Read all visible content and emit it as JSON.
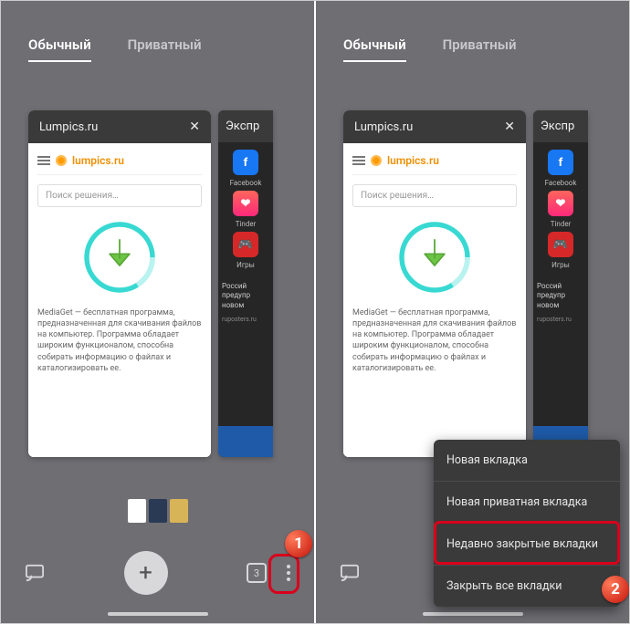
{
  "modes": {
    "normal": "Обычный",
    "private": "Приватный"
  },
  "card1": {
    "title": "Lumpics.ru",
    "brand": "lumpics.ru",
    "search_placeholder": "Поиск решения…",
    "body": "MediaGet — бесплатная программа, предназначенная для скачивания файлов на компьютер. Программа обладает широким функционалом, способна собирать информацию о файлах и каталогизировать ее."
  },
  "card2": {
    "title": "Экспр",
    "apps": {
      "fb": "Facebook",
      "tinder": "Tinder",
      "games": "Игры"
    },
    "news": "Россий\nпредупр\nновом",
    "source": "ruposters.ru"
  },
  "toolbar": {
    "tab_count": "3"
  },
  "menu": {
    "new_tab": "Новая вкладка",
    "new_private": "Новая приватная вкладка",
    "recent_closed": "Недавно закрытые вкладки",
    "close_all": "Закрыть все вкладки"
  },
  "badges": {
    "step1": "1",
    "step2": "2"
  }
}
